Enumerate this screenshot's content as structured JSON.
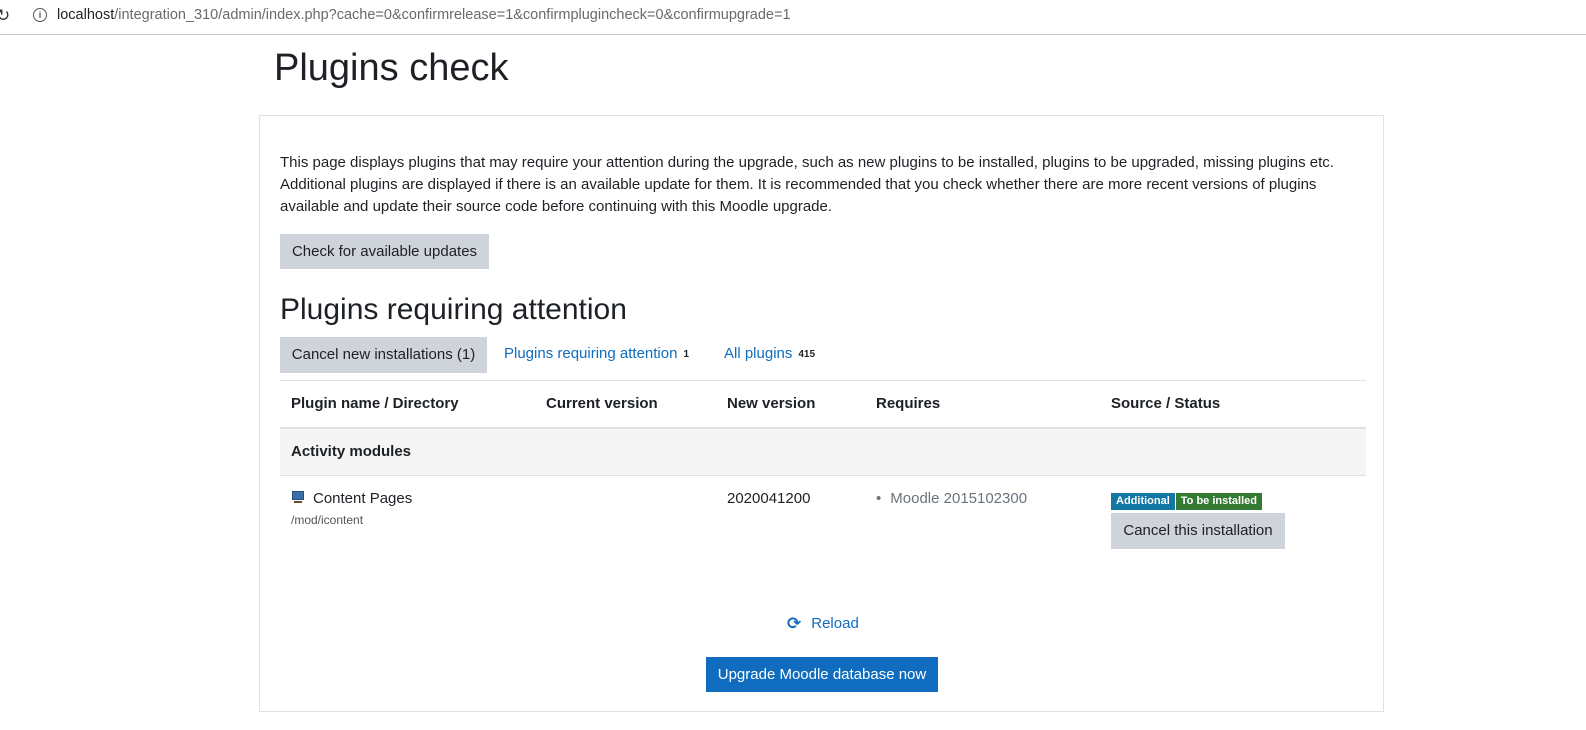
{
  "browser": {
    "url_host": "localhost",
    "url_path": "/integration_310/admin/index.php?cache=0&confirmrelease=1&confirmplugincheck=0&confirmupgrade=1"
  },
  "page": {
    "title": "Plugins check",
    "intro": "This page displays plugins that may require your attention during the upgrade, such as new plugins to be installed, plugins to be upgraded, missing plugins etc. Additional plugins are displayed if there is an available update for them. It is recommended that you check whether there are more recent versions of plugins available and update their source code before continuing with this Moodle upgrade.",
    "check_updates_label": "Check for available updates",
    "section_title": "Plugins requiring attention"
  },
  "filters": {
    "cancel_new_label": "Cancel new installations (1)",
    "requiring_attention_label": "Plugins requiring attention",
    "requiring_attention_count": "1",
    "all_plugins_label": "All plugins",
    "all_plugins_count": "415"
  },
  "table": {
    "headers": [
      "Plugin name / Directory",
      "Current version",
      "New version",
      "Requires",
      "Source / Status"
    ],
    "groups": [
      {
        "name": "Activity modules",
        "plugins": [
          {
            "name": "Content Pages",
            "directory": "/mod/icontent",
            "current_version": "",
            "new_version": "2020041200",
            "requires": [
              "Moodle 2015102300"
            ],
            "source_badge": "Additional",
            "status_badge": "To be installed",
            "action_label": "Cancel this installation",
            "icon": "monitor-icon"
          }
        ]
      }
    ]
  },
  "actions": {
    "reload_label": "Reload",
    "upgrade_label": "Upgrade Moodle database now"
  },
  "colors": {
    "link": "#0f6cbf",
    "primary": "#0f6cbf",
    "secondary": "#ced4da",
    "badge_info": "#1177a3",
    "badge_success": "#357a32"
  }
}
